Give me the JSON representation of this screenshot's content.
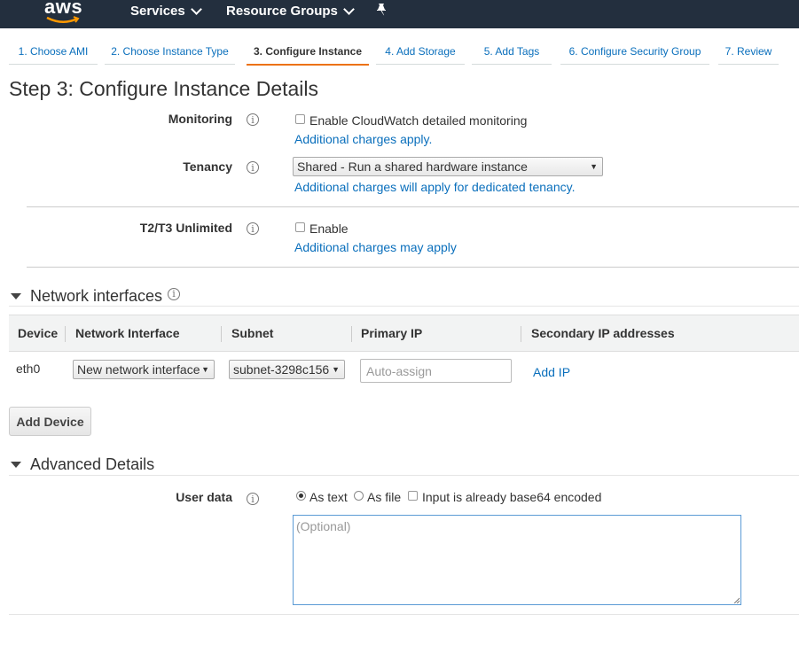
{
  "header": {
    "logo": "aws",
    "services": "Services",
    "resource_groups": "Resource Groups"
  },
  "steps": [
    {
      "label": "1. Choose AMI"
    },
    {
      "label": "2. Choose Instance Type"
    },
    {
      "label": "3. Configure Instance",
      "active": true
    },
    {
      "label": "4. Add Storage"
    },
    {
      "label": "5. Add Tags"
    },
    {
      "label": "6. Configure Security Group"
    },
    {
      "label": "7. Review"
    }
  ],
  "page_title": "Step 3: Configure Instance Details",
  "monitoring": {
    "label": "Monitoring",
    "checkbox_label": "Enable CloudWatch detailed monitoring",
    "checked": false,
    "link": "Additional charges apply."
  },
  "tenancy": {
    "label": "Tenancy",
    "selected": "Shared - Run a shared hardware instance",
    "link": "Additional charges will apply for dedicated tenancy."
  },
  "unlimited": {
    "label": "T2/T3 Unlimited",
    "checkbox_label": "Enable",
    "checked": false,
    "link": "Additional charges may apply"
  },
  "network": {
    "title": "Network interfaces",
    "columns": [
      "Device",
      "Network Interface",
      "Subnet",
      "Primary IP",
      "Secondary IP addresses"
    ],
    "rows": [
      {
        "device": "eth0",
        "interface": "New network interface",
        "subnet": "subnet-3298c156",
        "primary_ip_placeholder": "Auto-assign",
        "add_ip": "Add IP"
      }
    ],
    "add_device": "Add Device"
  },
  "advanced": {
    "title": "Advanced Details",
    "user_data_label": "User data",
    "as_text": "As text",
    "as_file": "As file",
    "base64": "Input is already base64 encoded",
    "selected": "As text",
    "textarea_placeholder": "(Optional)"
  },
  "colors": {
    "header_bg": "#232f3e",
    "link": "#0a6fbc",
    "active_step": "#ec7211"
  }
}
